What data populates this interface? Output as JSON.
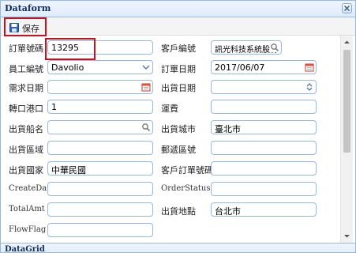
{
  "window": {
    "title": "Dataform"
  },
  "toolbar": {
    "save_label": "保存"
  },
  "form": {
    "order_no": {
      "label": "訂單號碼",
      "value": "13295"
    },
    "customer_no": {
      "label": "客戶編號",
      "value": "訊光科技系統股份"
    },
    "employee_no": {
      "label": "員工編號",
      "value": "Davolio"
    },
    "order_date": {
      "label": "訂單日期",
      "value": "2017/06/07"
    },
    "required_date": {
      "label": "需求日期",
      "value": ""
    },
    "shipped_date": {
      "label": "出貨日期",
      "value": ""
    },
    "port": {
      "label": "轉口港口",
      "value": "1"
    },
    "freight": {
      "label": "運費",
      "value": ""
    },
    "ship_name": {
      "label": "出貨船名",
      "value": ""
    },
    "ship_city": {
      "label": "出貨城市",
      "value": "臺北市"
    },
    "ship_region": {
      "label": "出貨區域",
      "value": ""
    },
    "postal_code": {
      "label": "郵遞區號",
      "value": ""
    },
    "ship_country": {
      "label": "出貨國家",
      "value": "中華民國"
    },
    "customer_order_no": {
      "label": "客戶訂單號碼",
      "value": ""
    },
    "create_date": {
      "label": "CreateDate",
      "value": ""
    },
    "order_status": {
      "label": "OrderStatus",
      "value": ""
    },
    "total_amt": {
      "label": "TotalAmt",
      "value": ""
    },
    "ship_address": {
      "label": "出貨地點",
      "value": "台北市"
    },
    "flow_flag": {
      "label": "FlowFlag",
      "value": ""
    }
  },
  "datagrid": {
    "title": "DataGrid"
  },
  "colors": {
    "accent_border": "#95b8e7",
    "header_bg": "#e0ecff",
    "highlight_red": "#c8101e",
    "title_text": "#0e2d5f"
  },
  "icons": {
    "close": "close-icon",
    "save": "floppy-disk-icon",
    "search": "search-icon",
    "calendar": "calendar-icon",
    "dropdown": "chevron-down-icon",
    "spinner": "spinner-icon"
  }
}
